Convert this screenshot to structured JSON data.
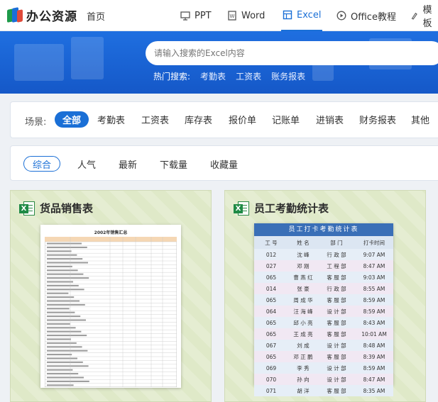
{
  "brand": {
    "name": "办公资源"
  },
  "nav": {
    "home": "首页",
    "tabs": [
      {
        "label": "PPT",
        "icon": "presentation-icon"
      },
      {
        "label": "Word",
        "icon": "document-icon"
      },
      {
        "label": "Excel",
        "icon": "spreadsheet-icon",
        "active": true
      },
      {
        "label": "Office教程",
        "icon": "play-icon"
      },
      {
        "label": "模板",
        "icon": "brush-icon"
      }
    ]
  },
  "search": {
    "placeholder": "请输入搜索的Excel内容"
  },
  "hot": {
    "label": "热门搜索:",
    "items": [
      "考勤表",
      "工资表",
      "账务报表"
    ]
  },
  "scene": {
    "label": "场景:",
    "items": [
      "全部",
      "考勤表",
      "工资表",
      "库存表",
      "报价单",
      "记账单",
      "进销表",
      "财务报表",
      "其他"
    ],
    "active_index": 0
  },
  "sort": {
    "items": [
      "综合",
      "人气",
      "最新",
      "下载量",
      "收藏量"
    ],
    "active_index": 0
  },
  "cards": [
    {
      "title": "货品销售表",
      "sheet_title": "2002年销售汇总"
    },
    {
      "title": "员工考勤统计表",
      "sheet_title": "员工打卡考勤统计表",
      "columns": [
        "工 号",
        "姓 名",
        "部 门",
        "打卡时间"
      ],
      "rows": [
        [
          "012",
          "沈 峰",
          "行 政 部",
          "9:07 AM"
        ],
        [
          "027",
          "邓 刚",
          "工 程 部",
          "8:47 AM"
        ],
        [
          "065",
          "曹 燕 红",
          "客 服 部",
          "9:03 AM"
        ],
        [
          "014",
          "张 豪",
          "行 政 部",
          "8:55 AM"
        ],
        [
          "065",
          "周 成 华",
          "客 服 部",
          "8:59 AM"
        ],
        [
          "064",
          "汪 海 峰",
          "设 计 部",
          "8:59 AM"
        ],
        [
          "065",
          "邱 小 亮",
          "客 服 部",
          "8:43 AM"
        ],
        [
          "065",
          "王 成 亮",
          "客 服 部",
          "10:01 AM"
        ],
        [
          "067",
          "刘 成",
          "设 计 部",
          "8:48 AM"
        ],
        [
          "065",
          "邓 正 鹏",
          "客 服 部",
          "8:39 AM"
        ],
        [
          "069",
          "李 秀",
          "设 计 部",
          "8:59 AM"
        ],
        [
          "070",
          "孙 向",
          "设 计 部",
          "8:47 AM"
        ],
        [
          "071",
          "胡 洋",
          "客 服 部",
          "8:35 AM"
        ]
      ]
    }
  ]
}
